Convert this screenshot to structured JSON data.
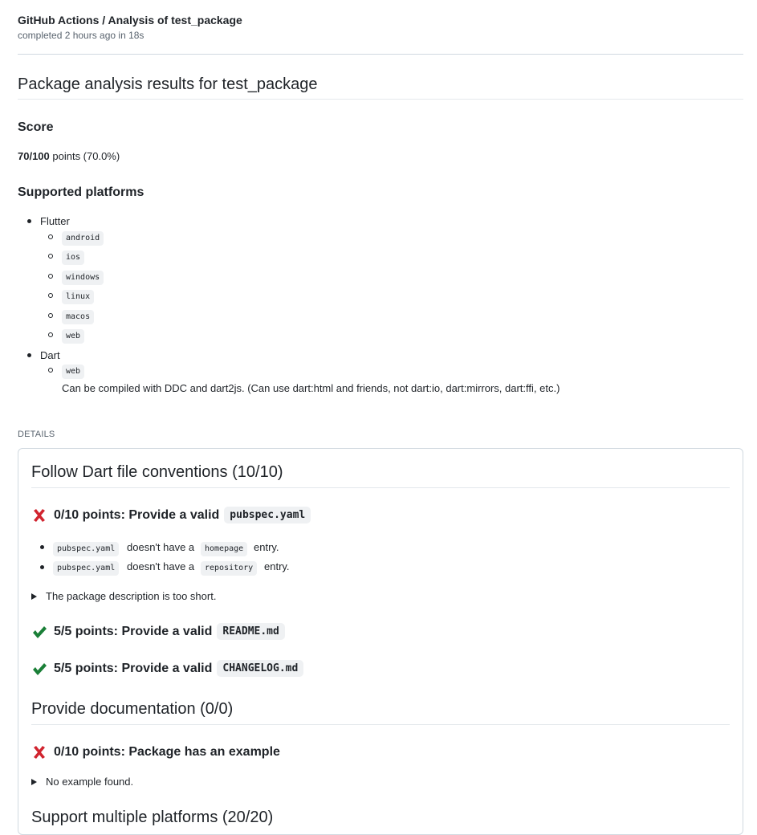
{
  "header": {
    "title": "GitHub Actions / Analysis of test_package",
    "subtitle": "completed 2 hours ago in 18s"
  },
  "main": {
    "title": "Package analysis results for test_package",
    "score_heading": "Score",
    "score_value": "70/100",
    "score_suffix": " points (70.0%)",
    "platforms_heading": "Supported platforms",
    "platforms": {
      "flutter_label": "Flutter",
      "flutter_items": [
        "android",
        "ios",
        "windows",
        "linux",
        "macos",
        "web"
      ],
      "dart_label": "Dart",
      "dart_items": [
        "web"
      ],
      "dart_note": "Can be compiled with DDC and dart2js. (Can use dart:html and friends, not dart:io, dart:mirrors, dart:ffi, etc.)"
    }
  },
  "details": {
    "label": "DETAILS",
    "sections": [
      {
        "title": "Follow Dart file conventions (10/10)",
        "checks": [
          {
            "status": "fail",
            "text": "0/10 points: Provide a valid",
            "code": "pubspec.yaml",
            "issues": [
              {
                "code1": "pubspec.yaml",
                "mid": "doesn't have a",
                "code2": "homepage",
                "end": "entry."
              },
              {
                "code1": "pubspec.yaml",
                "mid": "doesn't have a",
                "code2": "repository",
                "end": "entry."
              }
            ],
            "summary": "The package description is too short."
          },
          {
            "status": "pass",
            "text": "5/5 points: Provide a valid",
            "code": "README.md"
          },
          {
            "status": "pass",
            "text": "5/5 points: Provide a valid",
            "code": "CHANGELOG.md"
          }
        ]
      },
      {
        "title": "Provide documentation (0/0)",
        "checks": [
          {
            "status": "fail",
            "text": "0/10 points: Package has an example",
            "summary": "No example found."
          }
        ]
      },
      {
        "title": "Support multiple platforms (20/20)"
      }
    ]
  },
  "colors": {
    "fail_icon": "#d1242f",
    "pass_icon": "#1a7f37",
    "text": "#1f2328",
    "muted": "#59636e",
    "code_bg": "#eff1f3",
    "border": "#d1d9e0"
  },
  "icons": {
    "fail": "cross-mark-icon",
    "pass": "check-mark-icon",
    "summary": "triangle-right-icon"
  }
}
